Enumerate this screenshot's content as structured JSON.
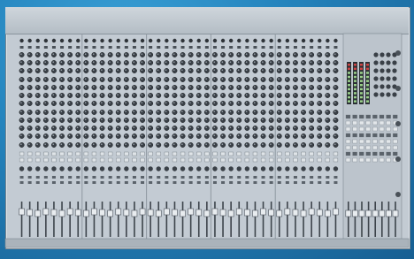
{
  "image": {
    "subject": "mixer-console",
    "palette": {
      "background": "#2584bd",
      "panel": "#c3cbd3",
      "knob": "#3a4047",
      "fader_cap": "#e8ecef",
      "meter": "#2b3035"
    }
  }
}
